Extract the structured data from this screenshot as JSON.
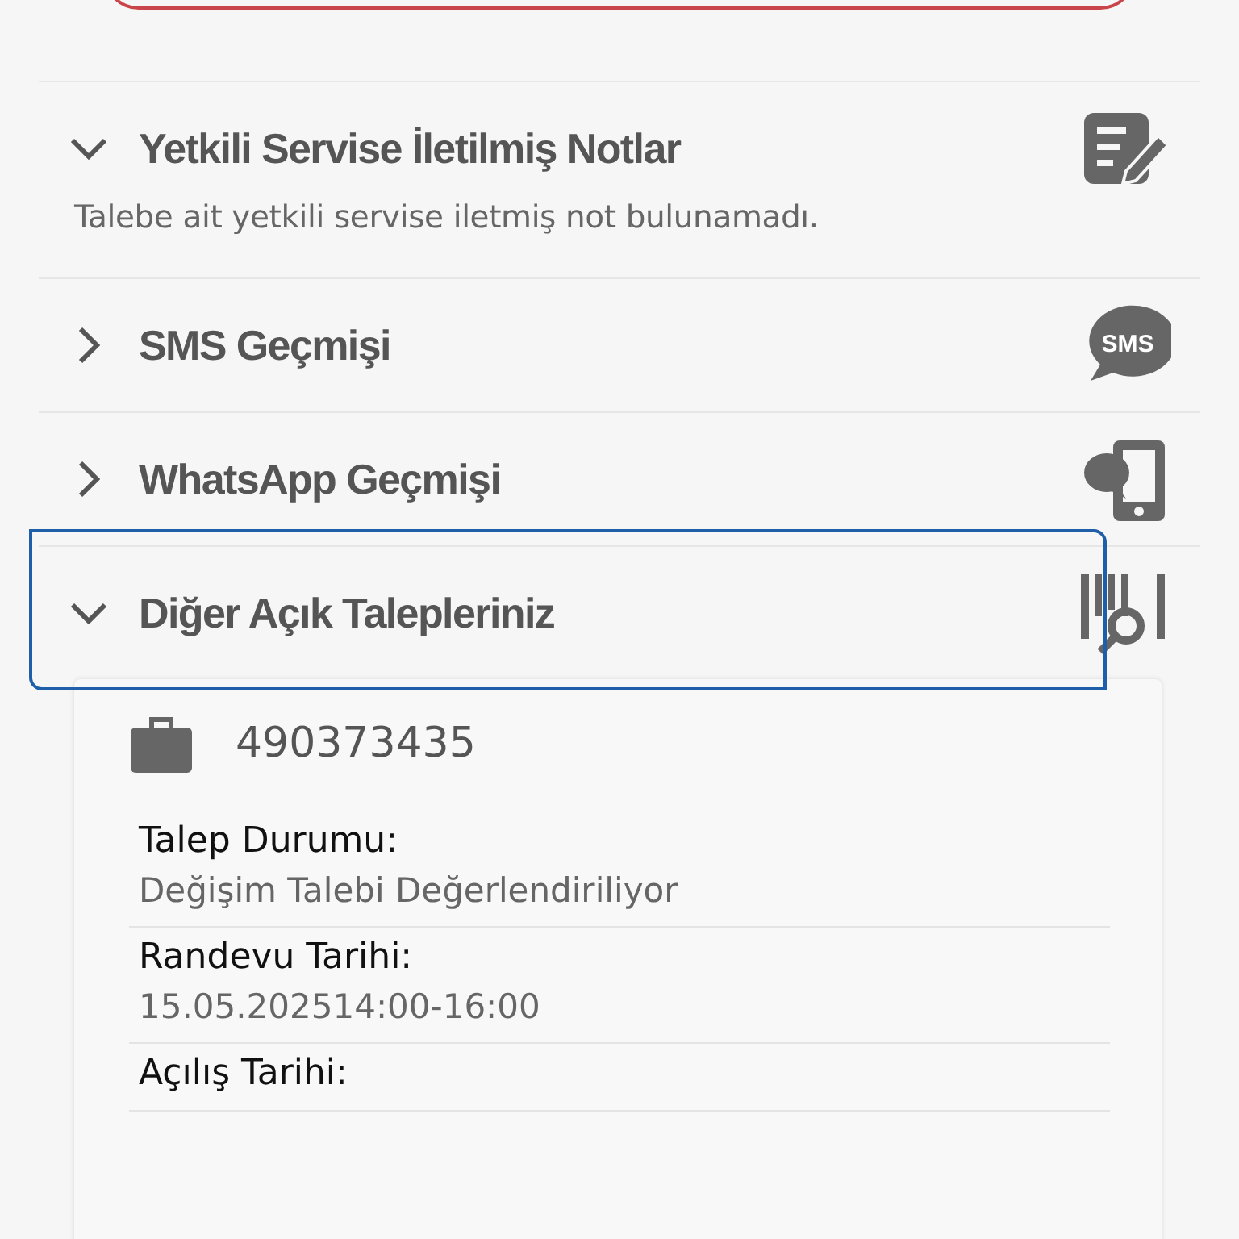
{
  "sections": [
    {
      "title": "Yetkili Servise İletilmiş Notlar",
      "expanded": true,
      "focused": false,
      "message": "Talebe ait yetkili servise iletmiş not bulunamadı."
    },
    {
      "title": "SMS Geçmişi",
      "expanded": false,
      "focused": false,
      "icon_text": "SMS"
    },
    {
      "title": "WhatsApp Geçmişi",
      "expanded": false,
      "focused": false
    },
    {
      "title": "Diğer Açık Talepleriniz",
      "expanded": true,
      "focused": true,
      "request": {
        "number": "490373435",
        "fields": [
          {
            "label": "Talep Durumu:",
            "value": "Değişim Talebi Değerlendiriliyor"
          },
          {
            "label": "Randevu Tarihi:",
            "value": "15.05.202514:00-16:00"
          },
          {
            "label": "Açılış Tarihi:"
          }
        ]
      }
    }
  ]
}
